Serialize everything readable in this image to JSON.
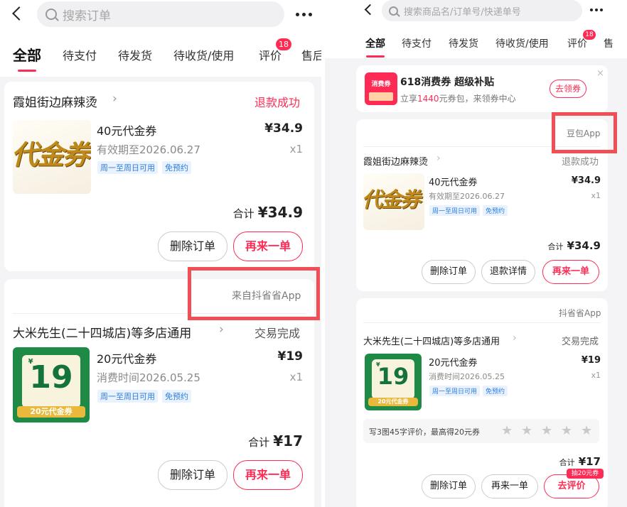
{
  "left": {
    "search_placeholder": "搜索订单",
    "tabs": [
      "全部",
      "待支付",
      "待发货",
      "待收货/使用",
      "评价",
      "售后"
    ],
    "review_badge": "18",
    "orders": [
      {
        "shop": "霞姐街边麻辣烫",
        "status": "退款成功",
        "thumb_text": "代金券",
        "title": "40元代金券",
        "subtitle": "有效期至2026.06.27",
        "price": "¥34.9",
        "qty": "x1",
        "tags": [
          "周一至周日可用",
          "免预约"
        ],
        "total_label": "合计",
        "total_value": "¥34.9",
        "buttons": [
          "删除订单",
          "再来一单"
        ]
      },
      {
        "source": "来自抖省省App",
        "shop": "大米先生(二十四城店)等多店通用",
        "status": "交易完成",
        "thumb_big": "19",
        "thumb_yen": "¥",
        "thumb_label": "20元代金券",
        "title": "20元代金券",
        "subtitle": "消费时间2026.05.25",
        "price": "¥19",
        "qty": "x1",
        "tags": [
          "周一至周日可用",
          "免预约"
        ],
        "total_label": "合计",
        "total_value": "¥17",
        "buttons": [
          "删除订单",
          "再来一单"
        ]
      }
    ]
  },
  "right": {
    "search_placeholder": "搜索商品名/订单号/快递单号",
    "tabs": [
      "全部",
      "待支付",
      "待发货",
      "待收货/使用",
      "评价",
      "售"
    ],
    "review_badge": "18",
    "promo": {
      "icon_text": "消费券",
      "title": "618消费券 超级补贴",
      "sub_prefix": "立享",
      "sub_amount": "1440",
      "sub_suffix": "元券包，来领券中心",
      "button": "去领券",
      "close": "×"
    },
    "orders": [
      {
        "source": "豆包App",
        "shop": "霞姐街边麻辣烫",
        "status": "退款成功",
        "thumb_text": "代金券",
        "title": "40元代金券",
        "subtitle": "有效期至2026.06.27",
        "price": "¥34.9",
        "qty": "x1",
        "tags": [
          "周一至周日可用",
          "免预约"
        ],
        "total_label": "合计",
        "total_value": "¥34.9",
        "buttons": [
          "删除订单",
          "退款详情",
          "再来一单"
        ]
      },
      {
        "source": "抖省省App",
        "shop": "大米先生(二十四城店)等多店通用",
        "status": "交易完成",
        "thumb_big": "19",
        "thumb_yen": "¥",
        "thumb_label": "20元代金券",
        "title": "20元代金券",
        "subtitle": "消费时间2026.05.25",
        "price": "¥19",
        "qty": "x1",
        "tags": [
          "周一至周日可用",
          "免预约"
        ],
        "review_tip": "写3图45字评价，最高得20元券",
        "total_label": "合计",
        "total_value": "¥17",
        "review_reward": "抽20元券",
        "buttons": [
          "删除订单",
          "再来一单",
          "去评价"
        ]
      }
    ]
  },
  "colors": {
    "accent": "#fe2c55",
    "highlight_box": "#ef4f55",
    "tag_blue": "#2a7de1"
  }
}
